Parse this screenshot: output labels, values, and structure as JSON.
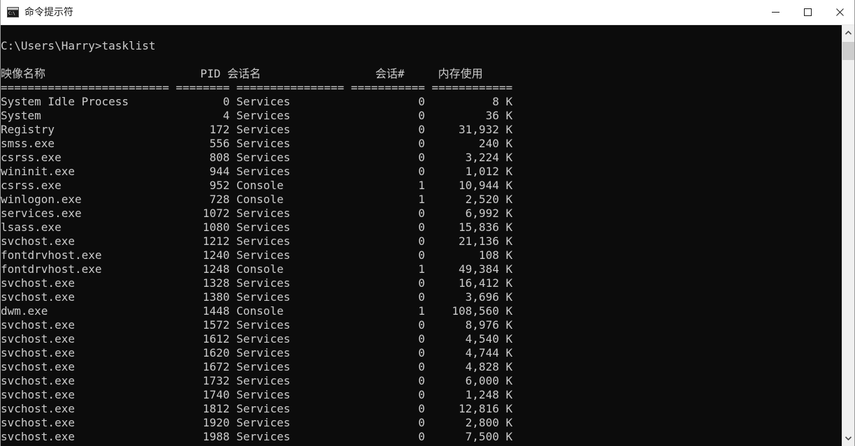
{
  "window": {
    "title": "命令提示符",
    "icon": "cmd-icon",
    "icon_text": "C:\\",
    "controls": {
      "minimize": "minimize-icon",
      "maximize": "maximize-icon",
      "close": "close-icon"
    }
  },
  "console": {
    "prompt_line": "C:\\Users\\Harry>tasklist",
    "colors": {
      "background": "#0c0c0c",
      "foreground": "#cccccc"
    },
    "columns": [
      {
        "key": "image_name",
        "label": "映像名称",
        "width": 25,
        "align": "left"
      },
      {
        "key": "pid",
        "label": "PID",
        "width": 8,
        "align": "right"
      },
      {
        "key": "session_name",
        "label": "会话名",
        "width": 16,
        "align": "left"
      },
      {
        "key": "session_num",
        "label": "会话#",
        "width": 11,
        "align": "right"
      },
      {
        "key": "mem_usage",
        "label": "内存使用",
        "width": 12,
        "align": "right"
      }
    ],
    "separator_widths": [
      25,
      8,
      16,
      11,
      12
    ],
    "rows": [
      {
        "image_name": "System Idle Process",
        "pid": "0",
        "session_name": "Services",
        "session_num": "0",
        "mem_usage": "8 K"
      },
      {
        "image_name": "System",
        "pid": "4",
        "session_name": "Services",
        "session_num": "0",
        "mem_usage": "36 K"
      },
      {
        "image_name": "Registry",
        "pid": "172",
        "session_name": "Services",
        "session_num": "0",
        "mem_usage": "31,932 K"
      },
      {
        "image_name": "smss.exe",
        "pid": "556",
        "session_name": "Services",
        "session_num": "0",
        "mem_usage": "240 K"
      },
      {
        "image_name": "csrss.exe",
        "pid": "808",
        "session_name": "Services",
        "session_num": "0",
        "mem_usage": "3,224 K"
      },
      {
        "image_name": "wininit.exe",
        "pid": "944",
        "session_name": "Services",
        "session_num": "0",
        "mem_usage": "1,012 K"
      },
      {
        "image_name": "csrss.exe",
        "pid": "952",
        "session_name": "Console",
        "session_num": "1",
        "mem_usage": "10,944 K"
      },
      {
        "image_name": "winlogon.exe",
        "pid": "728",
        "session_name": "Console",
        "session_num": "1",
        "mem_usage": "2,520 K"
      },
      {
        "image_name": "services.exe",
        "pid": "1072",
        "session_name": "Services",
        "session_num": "0",
        "mem_usage": "6,992 K"
      },
      {
        "image_name": "lsass.exe",
        "pid": "1080",
        "session_name": "Services",
        "session_num": "0",
        "mem_usage": "15,836 K"
      },
      {
        "image_name": "svchost.exe",
        "pid": "1212",
        "session_name": "Services",
        "session_num": "0",
        "mem_usage": "21,136 K"
      },
      {
        "image_name": "fontdrvhost.exe",
        "pid": "1240",
        "session_name": "Services",
        "session_num": "0",
        "mem_usage": "108 K"
      },
      {
        "image_name": "fontdrvhost.exe",
        "pid": "1248",
        "session_name": "Console",
        "session_num": "1",
        "mem_usage": "49,384 K"
      },
      {
        "image_name": "svchost.exe",
        "pid": "1328",
        "session_name": "Services",
        "session_num": "0",
        "mem_usage": "16,412 K"
      },
      {
        "image_name": "svchost.exe",
        "pid": "1380",
        "session_name": "Services",
        "session_num": "0",
        "mem_usage": "3,696 K"
      },
      {
        "image_name": "dwm.exe",
        "pid": "1448",
        "session_name": "Console",
        "session_num": "1",
        "mem_usage": "108,560 K"
      },
      {
        "image_name": "svchost.exe",
        "pid": "1572",
        "session_name": "Services",
        "session_num": "0",
        "mem_usage": "8,976 K"
      },
      {
        "image_name": "svchost.exe",
        "pid": "1612",
        "session_name": "Services",
        "session_num": "0",
        "mem_usage": "4,540 K"
      },
      {
        "image_name": "svchost.exe",
        "pid": "1620",
        "session_name": "Services",
        "session_num": "0",
        "mem_usage": "4,744 K"
      },
      {
        "image_name": "svchost.exe",
        "pid": "1672",
        "session_name": "Services",
        "session_num": "0",
        "mem_usage": "4,828 K"
      },
      {
        "image_name": "svchost.exe",
        "pid": "1732",
        "session_name": "Services",
        "session_num": "0",
        "mem_usage": "6,000 K"
      },
      {
        "image_name": "svchost.exe",
        "pid": "1740",
        "session_name": "Services",
        "session_num": "0",
        "mem_usage": "1,248 K"
      },
      {
        "image_name": "svchost.exe",
        "pid": "1812",
        "session_name": "Services",
        "session_num": "0",
        "mem_usage": "12,816 K"
      },
      {
        "image_name": "svchost.exe",
        "pid": "1920",
        "session_name": "Services",
        "session_num": "0",
        "mem_usage": "2,800 K"
      },
      {
        "image_name": "svchost.exe",
        "pid": "1988",
        "session_name": "Services",
        "session_num": "0",
        "mem_usage": "7,500 K"
      }
    ]
  },
  "scrollbar": {
    "up_arrow": "chevron-up-icon",
    "down_arrow": "chevron-down-icon"
  }
}
